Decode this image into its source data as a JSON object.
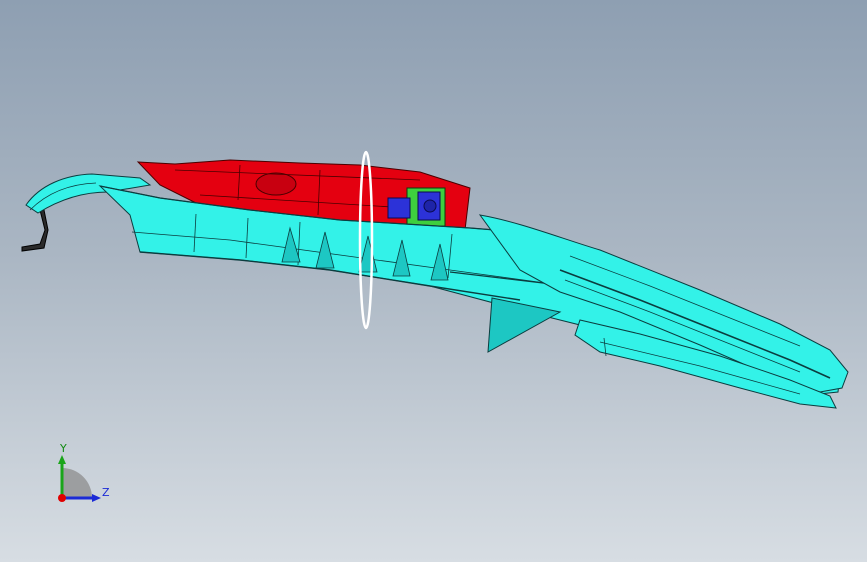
{
  "viewport": {
    "background_top": "#8e9fb2",
    "background_bottom": "#d7dde3"
  },
  "model": {
    "colors": {
      "shell": "#33f2e8",
      "shell_dark": "#1dc7c3",
      "edge": "#0b3d3f",
      "frame": "#e40010",
      "frame_edge": "#4a0000",
      "bracket_green": "#3ecf3e",
      "bracket_blue": "#2c32d8",
      "plane": "#ffffff"
    }
  },
  "triad": {
    "y_label": "Y",
    "z_label": "Z",
    "y_color": "#1aa51a",
    "z_color": "#1b2ad6",
    "origin_color": "#e00000"
  }
}
